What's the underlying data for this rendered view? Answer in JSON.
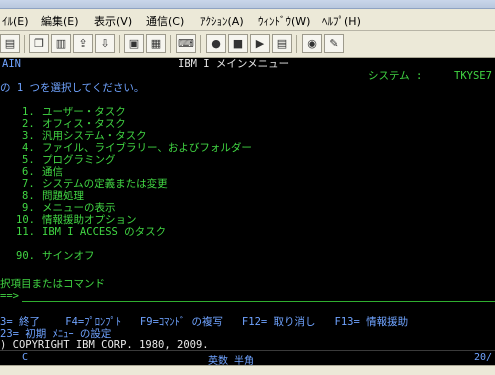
{
  "menu": [
    "ｲﾙ(E)",
    "編集(E)",
    "表示(V)",
    "通信(C)",
    "ｱｸｼｮﾝ(A)",
    "ｳｨﾝﾄﾞｳ(W)",
    "ﾍﾙﾌﾟ(H)"
  ],
  "screen": {
    "program": "AIN",
    "title": "IBM I メインメニュー",
    "system_label": "システム :",
    "system_value": "TKYSE7",
    "instruction": "の 1 つを選択してください。",
    "options": [
      {
        "num": "1.",
        "label": "ユーザー・タスク"
      },
      {
        "num": "2.",
        "label": "オフィス・タスク"
      },
      {
        "num": "3.",
        "label": "汎用システム・タスク"
      },
      {
        "num": "4.",
        "label": "ファイル、ライブラリー、およびフォルダー"
      },
      {
        "num": "5.",
        "label": "プログラミング"
      },
      {
        "num": "6.",
        "label": "通信"
      },
      {
        "num": "7.",
        "label": "システムの定義または変更"
      },
      {
        "num": "8.",
        "label": "問題処理"
      },
      {
        "num": "9.",
        "label": "メニューの表示"
      },
      {
        "num": "10.",
        "label": "情報援助オプション"
      },
      {
        "num": "11.",
        "label": "IBM I ACCESS のタスク"
      }
    ],
    "signoff": {
      "num": "90.",
      "label": "サインオフ"
    },
    "prompt_label": "択項目またはコマンド",
    "prompt_arrow": "==>",
    "fkeys_line1": "3= 終了    F4=ﾌﾟﾛﾝﾌﾟﾄ   F9=ｺﾏﾝﾄﾞ の複写   F12= 取り消し   F13= 情報援助",
    "fkeys_line2": "23= 初期 ﾒﾆｭｰ の設定",
    "copyright": ") COPYRIGHT IBM CORP. 1980, 2009."
  },
  "status": {
    "left": "C",
    "mode": "英数 半角",
    "right": "20/"
  }
}
